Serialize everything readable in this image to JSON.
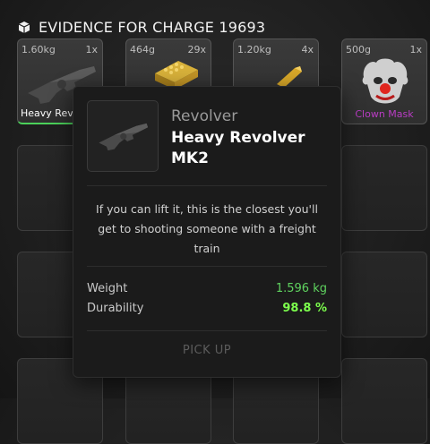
{
  "header": {
    "title": "EVIDENCE FOR CHARGE 19693",
    "icon": "box-icon"
  },
  "slots": [
    {
      "weight": "1.60kg",
      "count": "1x",
      "label": "Heavy Revolver MK2",
      "visible_label": "Heavy Rev"
    },
    {
      "weight": "464g",
      "count": "29x",
      "label": ""
    },
    {
      "weight": "1.20kg",
      "count": "4x",
      "label": ""
    },
    {
      "weight": "500g",
      "count": "1x",
      "label": "Clown Mask"
    }
  ],
  "tooltip": {
    "category": "Revolver",
    "name": "Heavy Revolver MK2",
    "description": "If you can lift it, this is the closest you'll get to shooting someone with a freight train",
    "stats": [
      {
        "label": "Weight",
        "value": "1.596 kg"
      },
      {
        "label": "Durability",
        "value": "98.8 %"
      }
    ],
    "action": "PICK UP"
  },
  "colors": {
    "selected_border": "#4bd15a",
    "clown_label": "#b93cc4",
    "stat_value": "#5fd35f"
  }
}
